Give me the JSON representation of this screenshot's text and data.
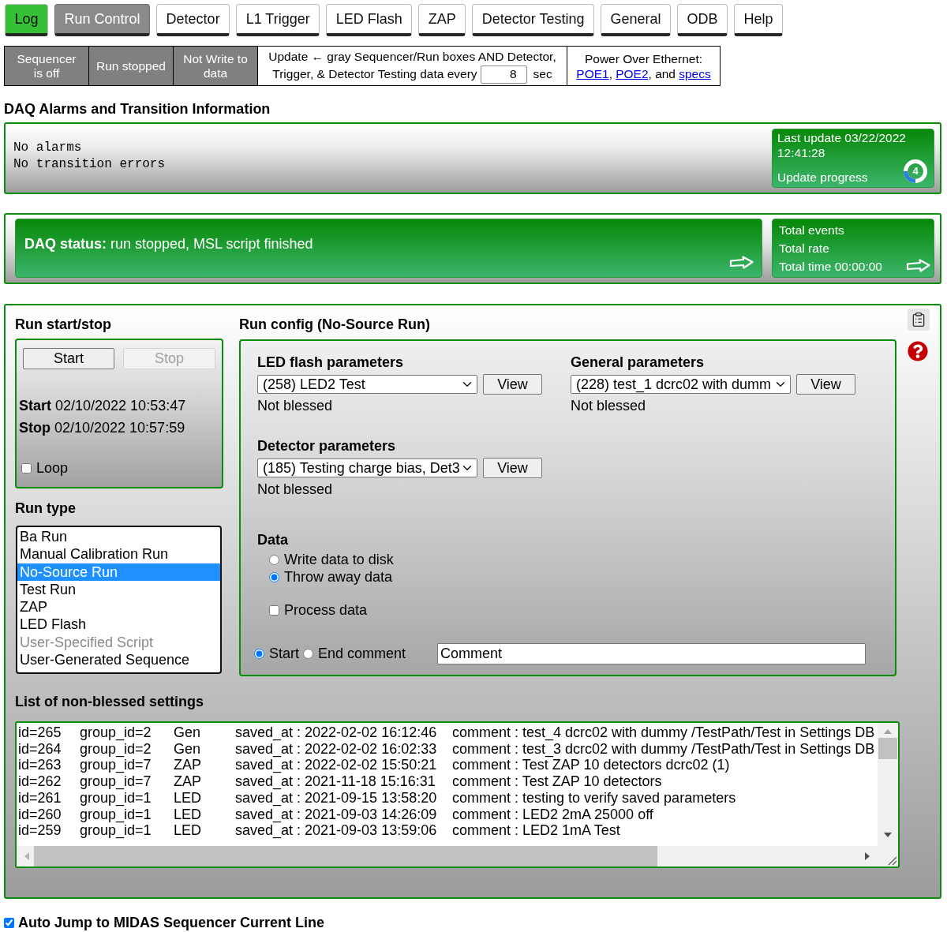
{
  "tabs": [
    {
      "label": "Log",
      "kind": "status",
      "selected": false
    },
    {
      "label": "Run Control",
      "kind": "page",
      "selected": true
    },
    {
      "label": "Detector",
      "kind": "page",
      "selected": false
    },
    {
      "label": "L1 Trigger",
      "kind": "page",
      "selected": false
    },
    {
      "label": "LED Flash",
      "kind": "page",
      "selected": false
    },
    {
      "label": "ZAP",
      "kind": "page",
      "selected": false
    },
    {
      "label": "Detector Testing",
      "kind": "page",
      "selected": false
    },
    {
      "label": "General",
      "kind": "page",
      "selected": false
    },
    {
      "label": "ODB",
      "kind": "page",
      "selected": false
    },
    {
      "label": "Help",
      "kind": "page",
      "selected": false
    }
  ],
  "status_bar": {
    "indicators": [
      {
        "label": "Sequencer is off",
        "on": false
      },
      {
        "label": "Run stopped",
        "on": false
      },
      {
        "label": "Not Write to data",
        "on": false
      }
    ],
    "update": {
      "lines": [
        "Update ← gray Sequencer/Run boxes AND Detector,",
        "Trigger, & Detector Testing data every"
      ],
      "interval": "8",
      "unit": "sec"
    },
    "power_over_ethernet": {
      "title": "Power Over Ethernet:",
      "parts": [
        {
          "kind": "link",
          "text": "POE1"
        },
        {
          "kind": "text",
          "text": ","
        },
        {
          "kind": "link",
          "text": "POE2"
        },
        {
          "kind": "text",
          "text": ", and"
        },
        {
          "kind": "link",
          "text": "specs"
        }
      ]
    }
  },
  "alarms": {
    "title": "DAQ Alarms and Transition Information",
    "messages": [
      "No alarms",
      "No transition errors"
    ],
    "last_update": "Last update 03/22/2022 12:41:28",
    "progress": {
      "label": "Update progress",
      "count": "4",
      "level": 0.25
    }
  },
  "daq_status": {
    "text": "**DAQ status:** run stopped, MSL script finished",
    "totals": [
      "Total events",
      "Total rate",
      "Total time 00:00:00"
    ]
  },
  "run_start_stop": {
    "title": "Run start/stop",
    "buttons": [
      {
        "label": "Start",
        "disabled": false
      },
      {
        "label": "Stop",
        "disabled": true
      }
    ],
    "times": [
      "**Start** 02/10/2022 10:53:47",
      "**Stop** 02/10/2022 10:57:59"
    ],
    "loop": {
      "label": "Loop",
      "checked": false
    }
  },
  "run_type": {
    "title": "Run type",
    "items": [
      {
        "label": "Ba Run",
        "selected": false,
        "disabled": false
      },
      {
        "label": "Manual Calibration Run",
        "selected": false,
        "disabled": false
      },
      {
        "label": "No-Source Run",
        "selected": true,
        "disabled": false
      },
      {
        "label": "Test Run",
        "selected": false,
        "disabled": false
      },
      {
        "label": "ZAP",
        "selected": false,
        "disabled": false
      },
      {
        "label": "LED Flash",
        "selected": false,
        "disabled": false
      },
      {
        "label": "User-Specified Script",
        "selected": false,
        "disabled": true
      },
      {
        "label": "User-Generated Sequence",
        "selected": false,
        "disabled": false
      }
    ]
  },
  "run_config": {
    "title": "Run config (No-Source Run)",
    "parameter_sets": [
      {
        "title": "LED flash parameters",
        "selection": "(258) LED2 Test",
        "button": "View",
        "status": "Not blessed"
      },
      {
        "title": "General parameters",
        "selection": "(228) test_1 dcrc02 with dumm",
        "button": "View",
        "status": "Not blessed"
      },
      {
        "title": "Detector parameters",
        "selection": "(185) Testing charge bias, Det3",
        "button": "View",
        "status": "Not blessed"
      }
    ],
    "data": {
      "title": "Data",
      "options": [
        {
          "label": "Write data to disk",
          "selected": false
        },
        {
          "label": "Throw away data",
          "selected": true
        }
      ],
      "process": {
        "label": "Process data",
        "checked": false
      }
    },
    "comment": {
      "options": [
        {
          "label": "Start",
          "selected": true
        },
        {
          "label": "End comment",
          "selected": false
        }
      ],
      "value": "Comment"
    }
  },
  "non_blessed_settings": {
    "title": "List of non-blessed settings",
    "rows": [
      {
        "id": "id=265",
        "group_id": "group_id=2",
        "group": "Gen",
        "saved_at": "saved_at : 2022-02-02 16:12:46",
        "comment": "comment : test_4 dcrc02 with dummy /TestPath/Test in Settings DB"
      },
      {
        "id": "id=264",
        "group_id": "group_id=2",
        "group": "Gen",
        "saved_at": "saved_at : 2022-02-02 16:02:33",
        "comment": "comment : test_3 dcrc02 with dummy /TestPath/Test in Settings DB"
      },
      {
        "id": "id=263",
        "group_id": "group_id=7",
        "group": "ZAP",
        "saved_at": "saved_at : 2022-02-02 15:50:21",
        "comment": "comment : Test ZAP 10 detectors dcrc02 (1)"
      },
      {
        "id": "id=262",
        "group_id": "group_id=7",
        "group": "ZAP",
        "saved_at": "saved_at : 2021-11-18 15:16:31",
        "comment": "comment : Test ZAP 10 detectors"
      },
      {
        "id": "id=261",
        "group_id": "group_id=1",
        "group": "LED",
        "saved_at": "saved_at : 2021-09-15 13:58:20",
        "comment": "comment : testing to verify saved parameters"
      },
      {
        "id": "id=260",
        "group_id": "group_id=1",
        "group": "LED",
        "saved_at": "saved_at : 2021-09-03 14:26:09",
        "comment": "comment : LED2 2mA 25000 off"
      },
      {
        "id": "id=259",
        "group_id": "group_id=1",
        "group": "LED",
        "saved_at": "saved_at : 2021-09-03 13:59:06",
        "comment": "comment : LED2 1mA Test"
      }
    ]
  },
  "auto_jump": {
    "label": "Auto Jump to MIDAS Sequencer Current Line",
    "checked": true
  }
}
